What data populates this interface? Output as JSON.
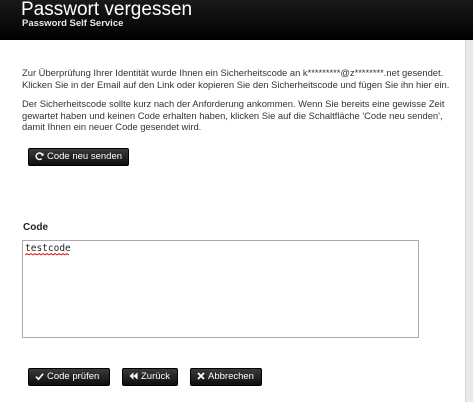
{
  "header": {
    "title": "Passwort vergessen",
    "subtitle": "Password Self Service"
  },
  "intro": {
    "line1": "Zur Überprüfung Ihrer Identität wurde Ihnen ein Sicherheitscode an k*********@z********.net gesendet.",
    "line2": "Klicken Sie in der Email auf den Link oder kopieren Sie den Sicherheitscode und fügen Sie ihn hier ein."
  },
  "notice": {
    "line1": "Der Sicherheitscode sollte kurz nach der Anforderung ankommen. Wenn Sie bereits eine gewisse Zeit",
    "line2": "gewartet haben und keinen Code erhalten haben, klicken Sie auf die Schaltfläche 'Code neu senden',",
    "line3": "damit Ihnen ein neuer Code gesendet wird."
  },
  "buttons": {
    "resend": "Code neu senden",
    "check": "Code prüfen",
    "back": "Zurück",
    "cancel": "Abbrechen"
  },
  "code_field": {
    "label": "Code",
    "value": "testcode"
  },
  "icons": {
    "resend": "refresh-icon",
    "check": "checkmark-icon",
    "back": "rewind-icon",
    "cancel": "x-icon"
  },
  "colors": {
    "header_bg": "#000000",
    "button_bg": "#1a1a1a",
    "page_bg": "#e9e9e9"
  }
}
